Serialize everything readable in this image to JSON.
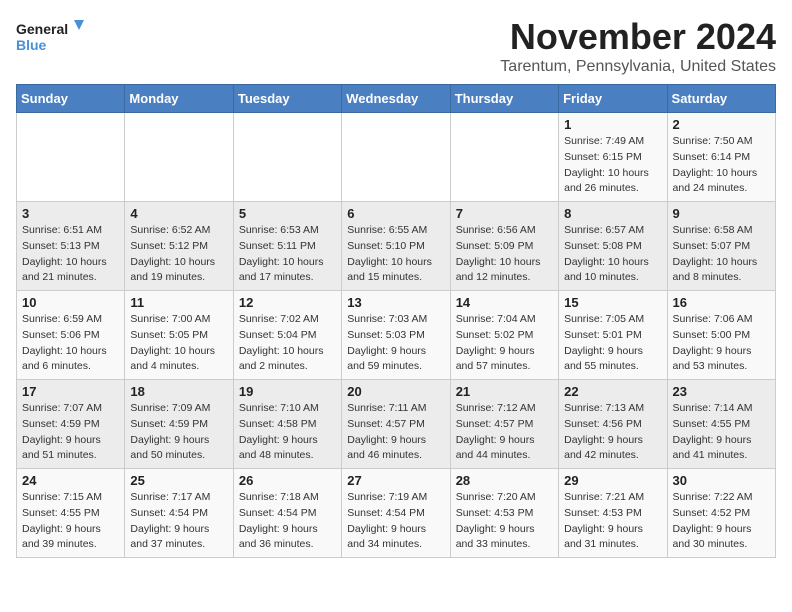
{
  "logo": {
    "text_general": "General",
    "text_blue": "Blue"
  },
  "title": "November 2024",
  "subtitle": "Tarentum, Pennsylvania, United States",
  "weekdays": [
    "Sunday",
    "Monday",
    "Tuesday",
    "Wednesday",
    "Thursday",
    "Friday",
    "Saturday"
  ],
  "weeks": [
    [
      {
        "day": "",
        "info": ""
      },
      {
        "day": "",
        "info": ""
      },
      {
        "day": "",
        "info": ""
      },
      {
        "day": "",
        "info": ""
      },
      {
        "day": "",
        "info": ""
      },
      {
        "day": "1",
        "info": "Sunrise: 7:49 AM\nSunset: 6:15 PM\nDaylight: 10 hours and 26 minutes."
      },
      {
        "day": "2",
        "info": "Sunrise: 7:50 AM\nSunset: 6:14 PM\nDaylight: 10 hours and 24 minutes."
      }
    ],
    [
      {
        "day": "3",
        "info": "Sunrise: 6:51 AM\nSunset: 5:13 PM\nDaylight: 10 hours and 21 minutes."
      },
      {
        "day": "4",
        "info": "Sunrise: 6:52 AM\nSunset: 5:12 PM\nDaylight: 10 hours and 19 minutes."
      },
      {
        "day": "5",
        "info": "Sunrise: 6:53 AM\nSunset: 5:11 PM\nDaylight: 10 hours and 17 minutes."
      },
      {
        "day": "6",
        "info": "Sunrise: 6:55 AM\nSunset: 5:10 PM\nDaylight: 10 hours and 15 minutes."
      },
      {
        "day": "7",
        "info": "Sunrise: 6:56 AM\nSunset: 5:09 PM\nDaylight: 10 hours and 12 minutes."
      },
      {
        "day": "8",
        "info": "Sunrise: 6:57 AM\nSunset: 5:08 PM\nDaylight: 10 hours and 10 minutes."
      },
      {
        "day": "9",
        "info": "Sunrise: 6:58 AM\nSunset: 5:07 PM\nDaylight: 10 hours and 8 minutes."
      }
    ],
    [
      {
        "day": "10",
        "info": "Sunrise: 6:59 AM\nSunset: 5:06 PM\nDaylight: 10 hours and 6 minutes."
      },
      {
        "day": "11",
        "info": "Sunrise: 7:00 AM\nSunset: 5:05 PM\nDaylight: 10 hours and 4 minutes."
      },
      {
        "day": "12",
        "info": "Sunrise: 7:02 AM\nSunset: 5:04 PM\nDaylight: 10 hours and 2 minutes."
      },
      {
        "day": "13",
        "info": "Sunrise: 7:03 AM\nSunset: 5:03 PM\nDaylight: 9 hours and 59 minutes."
      },
      {
        "day": "14",
        "info": "Sunrise: 7:04 AM\nSunset: 5:02 PM\nDaylight: 9 hours and 57 minutes."
      },
      {
        "day": "15",
        "info": "Sunrise: 7:05 AM\nSunset: 5:01 PM\nDaylight: 9 hours and 55 minutes."
      },
      {
        "day": "16",
        "info": "Sunrise: 7:06 AM\nSunset: 5:00 PM\nDaylight: 9 hours and 53 minutes."
      }
    ],
    [
      {
        "day": "17",
        "info": "Sunrise: 7:07 AM\nSunset: 4:59 PM\nDaylight: 9 hours and 51 minutes."
      },
      {
        "day": "18",
        "info": "Sunrise: 7:09 AM\nSunset: 4:59 PM\nDaylight: 9 hours and 50 minutes."
      },
      {
        "day": "19",
        "info": "Sunrise: 7:10 AM\nSunset: 4:58 PM\nDaylight: 9 hours and 48 minutes."
      },
      {
        "day": "20",
        "info": "Sunrise: 7:11 AM\nSunset: 4:57 PM\nDaylight: 9 hours and 46 minutes."
      },
      {
        "day": "21",
        "info": "Sunrise: 7:12 AM\nSunset: 4:57 PM\nDaylight: 9 hours and 44 minutes."
      },
      {
        "day": "22",
        "info": "Sunrise: 7:13 AM\nSunset: 4:56 PM\nDaylight: 9 hours and 42 minutes."
      },
      {
        "day": "23",
        "info": "Sunrise: 7:14 AM\nSunset: 4:55 PM\nDaylight: 9 hours and 41 minutes."
      }
    ],
    [
      {
        "day": "24",
        "info": "Sunrise: 7:15 AM\nSunset: 4:55 PM\nDaylight: 9 hours and 39 minutes."
      },
      {
        "day": "25",
        "info": "Sunrise: 7:17 AM\nSunset: 4:54 PM\nDaylight: 9 hours and 37 minutes."
      },
      {
        "day": "26",
        "info": "Sunrise: 7:18 AM\nSunset: 4:54 PM\nDaylight: 9 hours and 36 minutes."
      },
      {
        "day": "27",
        "info": "Sunrise: 7:19 AM\nSunset: 4:54 PM\nDaylight: 9 hours and 34 minutes."
      },
      {
        "day": "28",
        "info": "Sunrise: 7:20 AM\nSunset: 4:53 PM\nDaylight: 9 hours and 33 minutes."
      },
      {
        "day": "29",
        "info": "Sunrise: 7:21 AM\nSunset: 4:53 PM\nDaylight: 9 hours and 31 minutes."
      },
      {
        "day": "30",
        "info": "Sunrise: 7:22 AM\nSunset: 4:52 PM\nDaylight: 9 hours and 30 minutes."
      }
    ]
  ]
}
